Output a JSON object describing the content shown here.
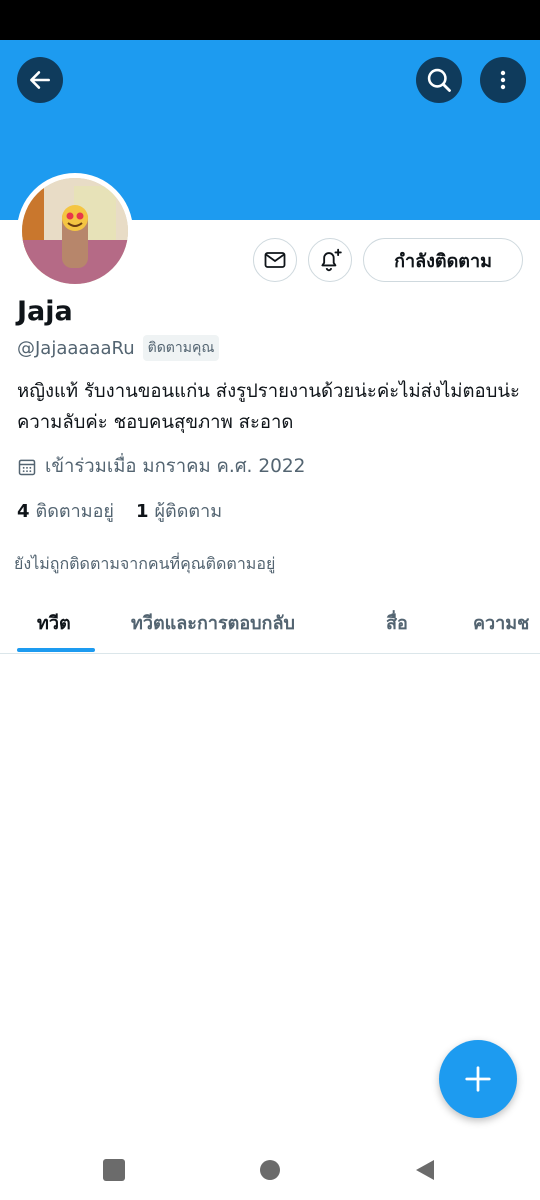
{
  "profile": {
    "name": "Jaja",
    "handle": "@JajaaaaaRu",
    "follows_you_badge": "ติดตามคุณ",
    "bio": "หญิงแท้ รับงานขอนแก่น ส่งรูปรายงานด้วยน่ะค่ะไม่ส่งไม่ตอบน่ะ ความลับค่ะ ชอบคนสุขภาพ สะอาด",
    "joined": "เข้าร่วมเมื่อ มกราคม ค.ศ. 2022",
    "following_count": "4",
    "following_label": "ติดตามอยู่",
    "followers_count": "1",
    "followers_label": "ผู้ติดตาม",
    "not_followed_note": "ยังไม่ถูกติดตามจากคนที่คุณติดตามอยู่"
  },
  "actions": {
    "following_button": "กำลังติดตาม"
  },
  "tabs": [
    {
      "label": "ทวีต",
      "active": true
    },
    {
      "label": "ทวีตและการตอบกลับ",
      "active": false
    },
    {
      "label": "สื่อ",
      "active": false
    },
    {
      "label": "ความช",
      "active": false
    }
  ],
  "icons": {
    "back": "arrow-left-icon",
    "search": "search-icon",
    "more": "more-vertical-icon",
    "message": "envelope-icon",
    "notify": "bell-plus-icon",
    "calendar": "calendar-icon",
    "compose": "plus-icon"
  },
  "colors": {
    "accent": "#1d9bf0",
    "banner": "#1d9bf0",
    "secondary_text": "#536471"
  }
}
